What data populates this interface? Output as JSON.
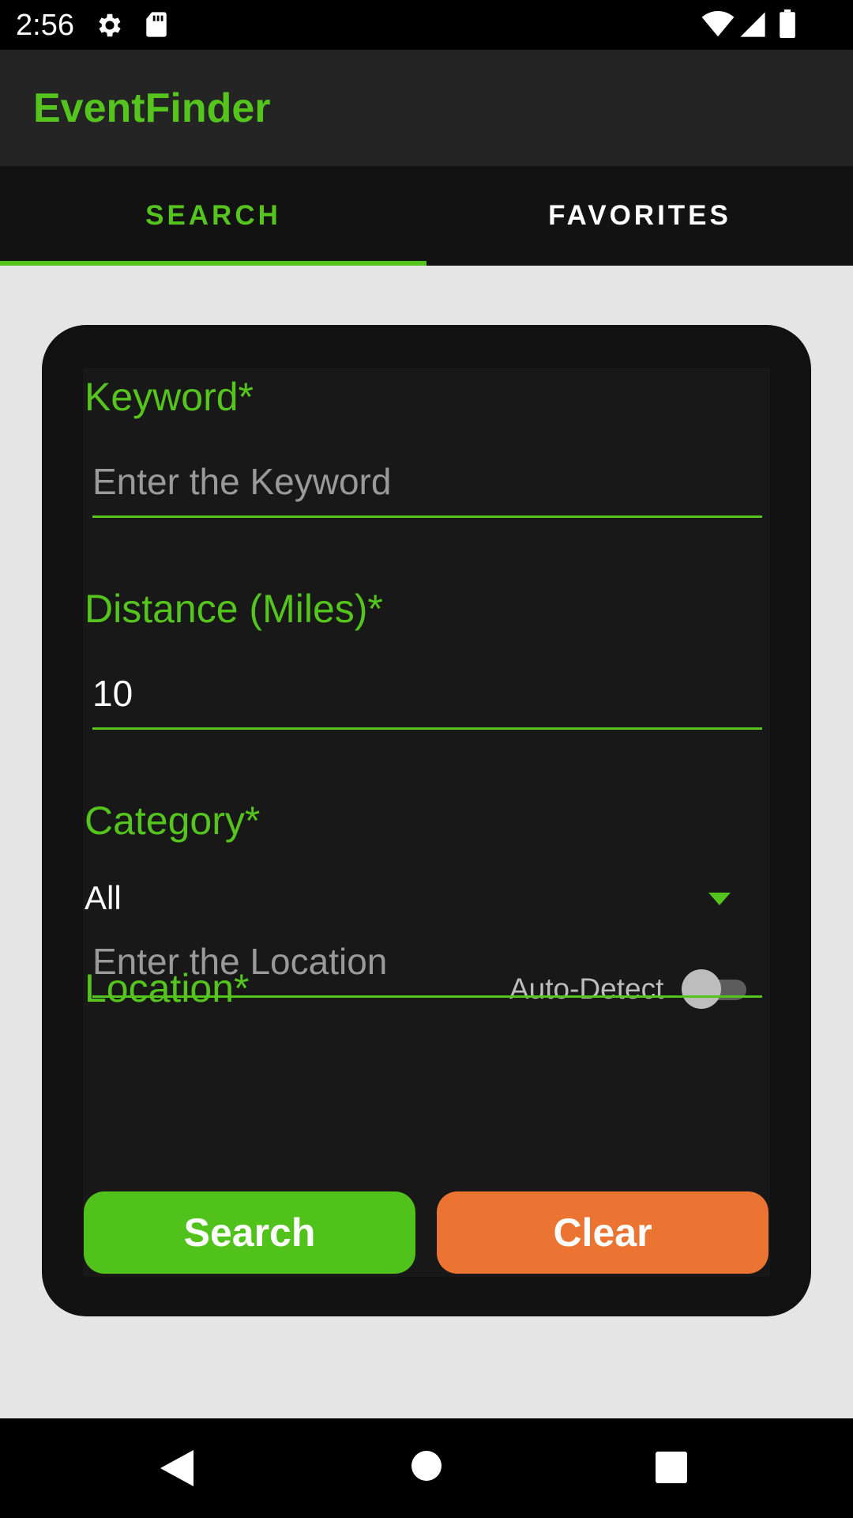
{
  "status_bar": {
    "time": "2:56",
    "icons": [
      "gear-icon",
      "sd-card-icon",
      "wifi-icon",
      "cell-signal-icon",
      "battery-icon"
    ]
  },
  "app_bar": {
    "title": "EventFinder"
  },
  "tabs": [
    {
      "label": "SEARCH",
      "selected": true
    },
    {
      "label": "FAVORITES",
      "selected": false
    }
  ],
  "form": {
    "keyword": {
      "label": "Keyword*",
      "placeholder": "Enter the Keyword",
      "value": ""
    },
    "distance": {
      "label": "Distance (Miles)*",
      "value": "10"
    },
    "category": {
      "label": "Category*",
      "selected": "All"
    },
    "location": {
      "label": "Location*",
      "auto_detect_label": "Auto-Detect",
      "auto_detect_on": false,
      "placeholder": "Enter the Location",
      "value": ""
    },
    "search_button": "Search",
    "clear_button": "Clear"
  },
  "colors": {
    "accent": "#55c51e",
    "search_button": "#50c21b",
    "clear_button": "#ec7432",
    "background": "#e5e5e5",
    "card": "#111111"
  },
  "nav_bar": {
    "icons": [
      "back-icon",
      "home-icon",
      "recents-icon"
    ]
  }
}
